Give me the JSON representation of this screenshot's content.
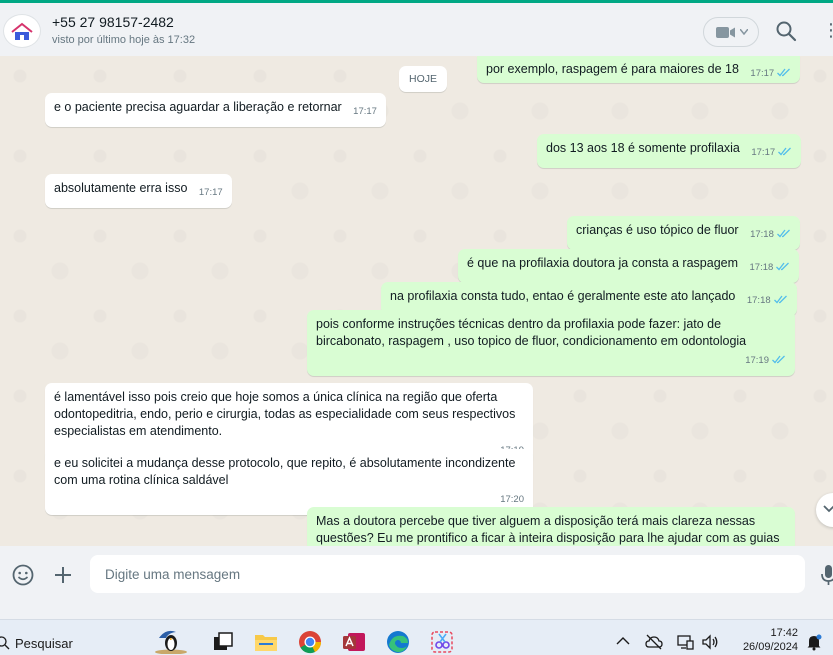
{
  "header": {
    "contact_name": "+55 27 98157-2482",
    "contact_status": "visto por último hoje às 17:32",
    "icons": [
      "video-call-icon",
      "search-icon",
      "more-options-icon"
    ]
  },
  "chat": {
    "day_divider": "HOJE",
    "messages": [
      {
        "dir": "out",
        "text": "por exemplo, raspagem é para maiores de 18",
        "time": "17:17",
        "read": true
      },
      {
        "dir": "in",
        "text": "e o paciente precisa aguardar a liberação e retornar",
        "time": "17:17"
      },
      {
        "dir": "out",
        "text": "dos 13 aos 18 é somente profilaxia",
        "time": "17:17",
        "read": true
      },
      {
        "dir": "in",
        "text": "absolutamente erra isso",
        "time": "17:17"
      },
      {
        "dir": "out",
        "text": "crianças é uso tópico de fluor",
        "time": "17:18",
        "read": true
      },
      {
        "dir": "out",
        "text": "é que na profilaxia doutora ja consta a raspagem",
        "time": "17:18",
        "read": true
      },
      {
        "dir": "out",
        "text": "na profilaxia consta tudo, entao é geralmente este ato lançado",
        "time": "17:18",
        "read": true
      },
      {
        "dir": "out",
        "text": "pois conforme instruções técnicas dentro da profilaxia pode fazer: jato de bircabonato, raspagem , uso topico de fluor, condicionamento em odontologia",
        "time": "17:19",
        "read": true
      },
      {
        "dir": "in",
        "text": "é lamentável isso pois creio que hoje somos a única clínica na região que oferta odontopeditria, endo, perio e cirurgia, todas as especialidade com seus respectivos especialistas em atendimento.",
        "time": "17:19"
      },
      {
        "dir": "in",
        "text": "e eu solicitei a mudança desse protocolo, que repito, é absolutamente incondizente com uma rotina clínica saldável",
        "time": "17:20"
      },
      {
        "dir": "out",
        "text": "Mas a doutora percebe que tiver alguem a disposição terá mais clareza nessas questões? Eu me prontifico a ficar à inteira disposição para lhe ajudar com as guias",
        "time": "",
        "read": false
      }
    ]
  },
  "composer": {
    "placeholder": "Digite uma mensagem",
    "icons": [
      "emoji-icon",
      "attach-plus-icon",
      "microphone-icon"
    ]
  },
  "taskbar": {
    "search_label": "Pesquisar",
    "time": "17:42",
    "date": "26/09/2024",
    "apps": [
      "penguin-widget-icon",
      "task-view-icon",
      "file-explorer-icon",
      "chrome-icon",
      "access-icon",
      "edge-icon",
      "snipping-tool-icon"
    ],
    "tray": [
      "chevron-up-icon",
      "cloud-off-icon",
      "device-icon",
      "speaker-icon",
      "notification-bell-icon"
    ]
  },
  "colors": {
    "accent": "#00a884",
    "outgoing_bubble": "#d9fdd3",
    "incoming_bubble": "#ffffff",
    "chat_bg": "#efeae2",
    "read_ticks": "#53bdeb"
  }
}
